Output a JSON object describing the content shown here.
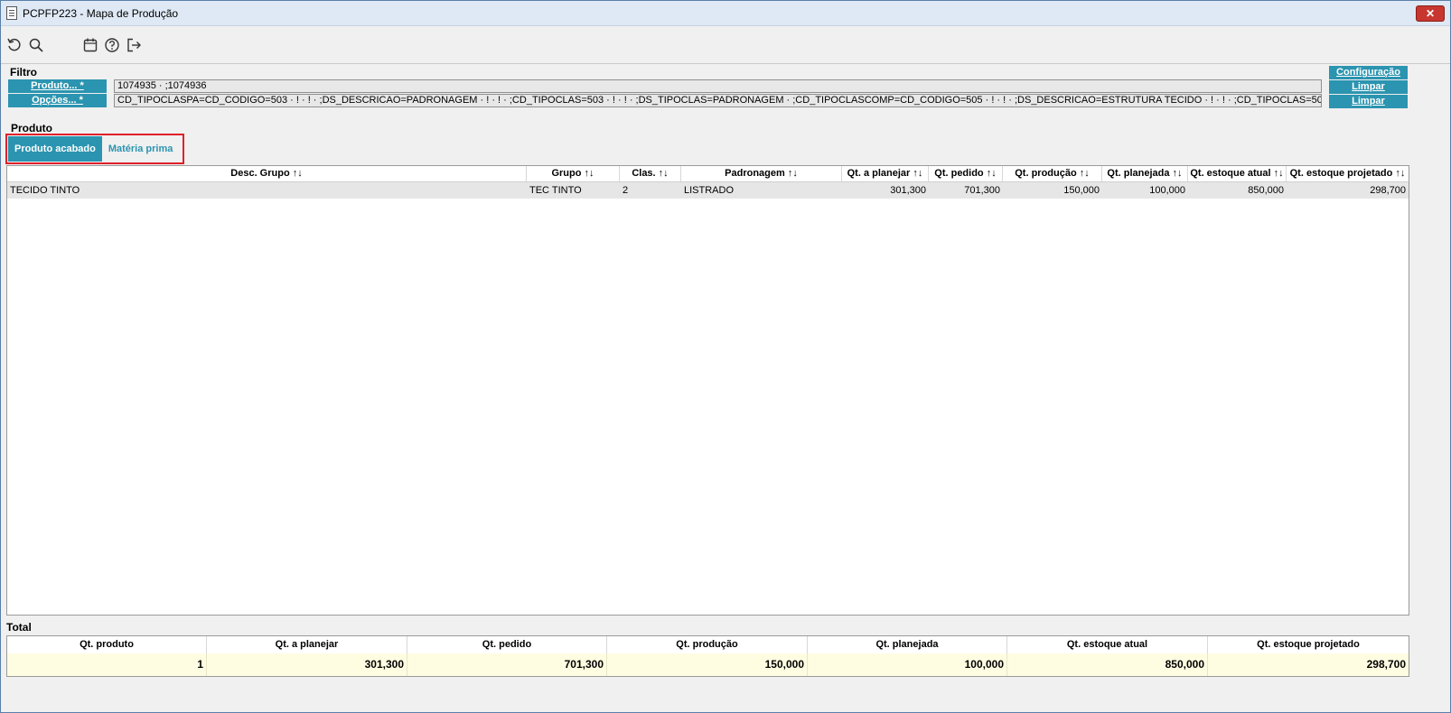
{
  "window": {
    "title": "PCPFP223 - Mapa de Produção",
    "close_label": "✕"
  },
  "toolbar": {
    "icons": [
      "refresh-icon",
      "search-icon",
      "calendar-icon",
      "help-icon",
      "exit-icon"
    ]
  },
  "filtro": {
    "label": "Filtro",
    "produto_label": "Produto... *",
    "produto_value": "1074935 · ;1074936",
    "opcoes_label": "Opções... *",
    "opcoes_value": "CD_TIPOCLASPA=CD_CODIGO=503 · ! · ! · ;DS_DESCRICAO=PADRONAGEM · ! · ! · ;CD_TIPOCLAS=503 · ! · ! · ;DS_TIPOCLAS=PADRONAGEM · ;CD_TIPOCLASCOMP=CD_CODIGO=505 · ! · ! · ;DS_DESCRICAO=ESTRUTURA TECIDO · ! · ! · ;CD_TIPOCLAS=505 · ! · ! · ;DS_TIPOCLAS=ESTRUTURA TECIDO · ;CD_",
    "configuracao_label": "Configuração",
    "limpar_label": "Limpar"
  },
  "produto": {
    "label": "Produto",
    "tabs": [
      {
        "label": "Produto acabado",
        "active": true
      },
      {
        "label": "Matéria prima",
        "active": false
      }
    ]
  },
  "grid": {
    "columns": [
      "Desc. Grupo ↑↓",
      "Grupo ↑↓",
      "Clas. ↑↓",
      "Padronagem ↑↓",
      "Qt. a planejar ↑↓",
      "Qt. pedido ↑↓",
      "Qt. produção ↑↓",
      "Qt. planejada ↑↓",
      "Qt. estoque atual ↑↓",
      "Qt. estoque projetado ↑↓"
    ],
    "rows": [
      [
        "TECIDO TINTO",
        "TEC TINTO",
        "2",
        "LISTRADO",
        "301,300",
        "701,300",
        "150,000",
        "100,000",
        "850,000",
        "298,700"
      ]
    ]
  },
  "total": {
    "label": "Total",
    "columns": [
      "Qt. produto",
      "Qt. a planejar",
      "Qt. pedido",
      "Qt. produção",
      "Qt. planejada",
      "Qt. estoque atual",
      "Qt. estoque projetado"
    ],
    "values": [
      "1",
      "301,300",
      "701,300",
      "150,000",
      "100,000",
      "850,000",
      "298,700"
    ]
  },
  "colors": {
    "accent": "#2b94b0",
    "highlight_border": "#e0202a",
    "total_row_bg": "#fffde1"
  }
}
